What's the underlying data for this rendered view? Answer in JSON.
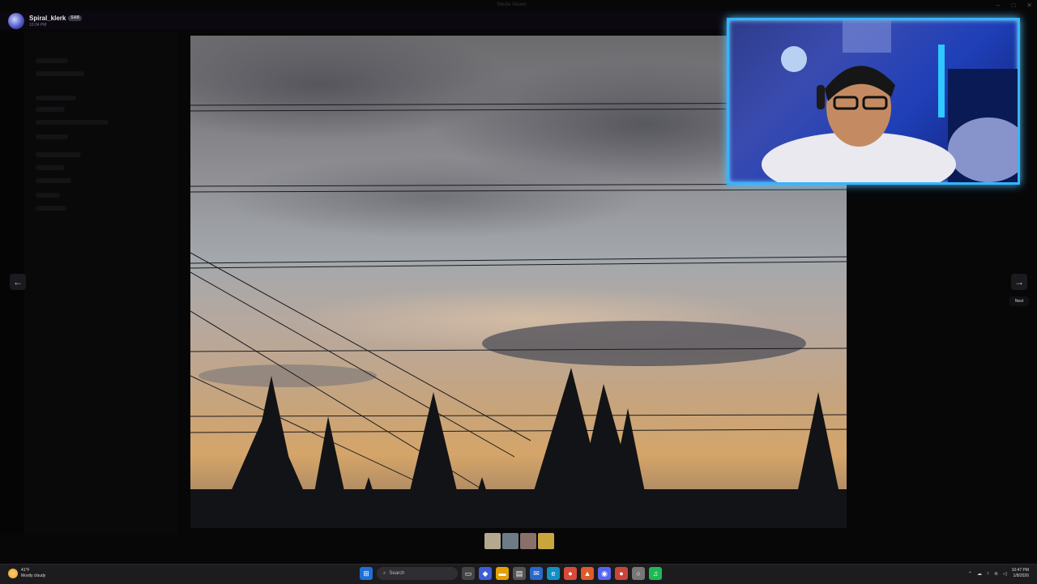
{
  "window": {
    "title": "Media Viewer"
  },
  "post": {
    "author": "Spiral_klerk",
    "tag": "SAB",
    "time": "10:34 PM"
  },
  "viewer": {
    "prev_icon": "arrow-left-icon",
    "next_icon": "arrow-right-icon",
    "next_tooltip": "Next"
  },
  "thumbnails": [
    {
      "label": "photo-1",
      "color": "#b5a890"
    },
    {
      "label": "photo-2",
      "color": "#6d7a88"
    },
    {
      "label": "photo-3",
      "color": "#8a6f6a"
    },
    {
      "label": "photo-4",
      "color": "#c8a63c"
    }
  ],
  "taskbar": {
    "weather_temp": "41°F",
    "weather_desc": "Mostly cloudy",
    "search_placeholder": "Search",
    "time": "10:47 PM",
    "date": "1/8/2026"
  },
  "colors": {
    "accent": "#36b4ff",
    "background": "#000000"
  }
}
